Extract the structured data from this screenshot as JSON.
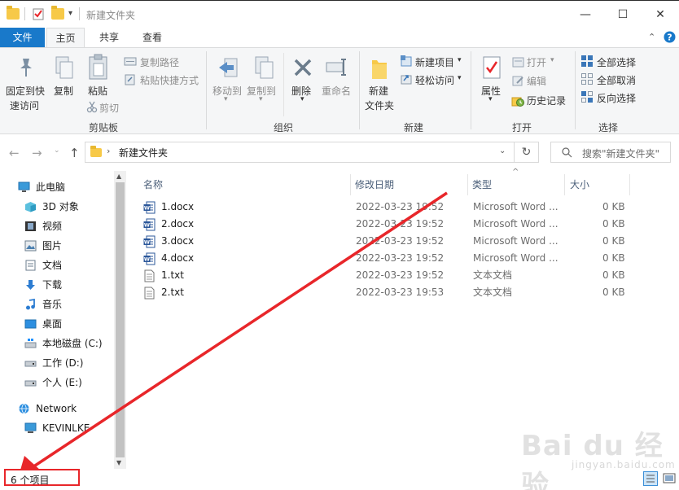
{
  "window": {
    "title": "新建文件夹",
    "minimize_glyph": "—",
    "maximize_glyph": "☐",
    "close_glyph": "✕"
  },
  "ribbon_tabs": {
    "file": "文件",
    "home": "主页",
    "share": "共享",
    "view": "查看"
  },
  "ribbon": {
    "clipboard": {
      "pin_line1": "固定到快",
      "pin_line2": "速访问",
      "copy": "复制",
      "paste": "粘贴",
      "copy_path": "复制路径",
      "paste_shortcut": "粘贴快捷方式",
      "cut": "剪切",
      "label": "剪贴板"
    },
    "organize": {
      "move_to": "移动到",
      "copy_to": "复制到",
      "delete": "删除",
      "rename": "重命名",
      "label": "组织"
    },
    "new": {
      "new_folder_line1": "新建",
      "new_folder_line2": "文件夹",
      "new_item": "新建项目",
      "easy_access": "轻松访问",
      "label": "新建"
    },
    "open": {
      "properties": "属性",
      "open": "打开",
      "edit": "编辑",
      "history": "历史记录",
      "label": "打开"
    },
    "select": {
      "select_all": "全部选择",
      "select_none": "全部取消",
      "invert": "反向选择",
      "label": "选择"
    }
  },
  "address": {
    "path": "新建文件夹",
    "search_placeholder": "搜索\"新建文件夹\""
  },
  "nav": {
    "items": [
      {
        "label": "此电脑"
      },
      {
        "label": "3D 对象"
      },
      {
        "label": "视频"
      },
      {
        "label": "图片"
      },
      {
        "label": "文档"
      },
      {
        "label": "下载"
      },
      {
        "label": "音乐"
      },
      {
        "label": "桌面"
      },
      {
        "label": "本地磁盘 (C:)"
      },
      {
        "label": "工作 (D:)"
      },
      {
        "label": "个人 (E:)"
      },
      {
        "label": "Network"
      },
      {
        "label": "KEVINLKE"
      }
    ]
  },
  "columns": {
    "name": "名称",
    "modified": "修改日期",
    "type": "类型",
    "size": "大小"
  },
  "files": [
    {
      "name": "1.docx",
      "modified": "2022-03-23 19:52",
      "type": "Microsoft Word ...",
      "size": "0 KB",
      "icon": "word-icon"
    },
    {
      "name": "2.docx",
      "modified": "2022-03-23 19:52",
      "type": "Microsoft Word ...",
      "size": "0 KB",
      "icon": "word-icon"
    },
    {
      "name": "3.docx",
      "modified": "2022-03-23 19:52",
      "type": "Microsoft Word ...",
      "size": "0 KB",
      "icon": "word-icon"
    },
    {
      "name": "4.docx",
      "modified": "2022-03-23 19:52",
      "type": "Microsoft Word ...",
      "size": "0 KB",
      "icon": "word-icon"
    },
    {
      "name": "1.txt",
      "modified": "2022-03-23 19:52",
      "type": "文本文档",
      "size": "0 KB",
      "icon": "text-file-icon"
    },
    {
      "name": "2.txt",
      "modified": "2022-03-23 19:53",
      "type": "文本文档",
      "size": "0 KB",
      "icon": "text-file-icon"
    }
  ],
  "status": {
    "item_count": "6 个项目"
  },
  "watermark": {
    "main": "Bai du 经验",
    "sub": "jingyan.baidu.com"
  },
  "colors": {
    "accent": "#1979ca",
    "annotation_red": "#e8262a",
    "folder_yellow": "#f7c948"
  }
}
